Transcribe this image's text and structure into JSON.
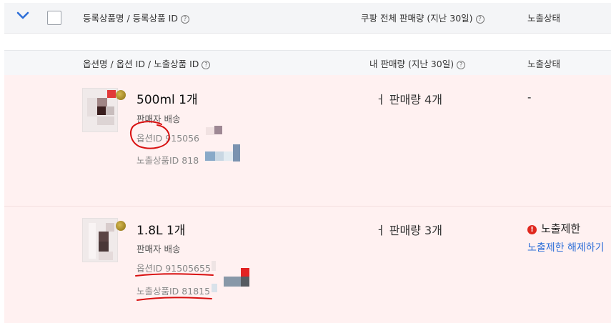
{
  "header": {
    "product_col": "등록상품명 / 등록상품 ID",
    "sales_col": "쿠팡 전체 판매량 (지난 30일)",
    "status_col": "노출상태",
    "help_glyph": "?"
  },
  "subheader": {
    "option_col": "옵션명 / 옵션 ID / 노출상품 ID",
    "sales_col": "내 판매량 (지난 30일)",
    "status_col": "노출상태",
    "help_glyph": "?"
  },
  "rows": [
    {
      "title": "500ml 1개",
      "shipping": "판매자 배송",
      "option_id": "옵션ID 915056",
      "exposure_id": "노출상품ID 818",
      "sales": "ㅓ 판매량 4개",
      "status": "-"
    },
    {
      "title": "1.8L 1개",
      "shipping": "판매자 배송",
      "option_id": "옵션ID 91505655",
      "exposure_id": "노출상품ID 81815",
      "sales": "ㅓ 판매량 3개",
      "status": "노출제한",
      "status_icon": "!",
      "action_link": "노출제한 해제하기"
    }
  ],
  "colors": {
    "row_bg": "#fff1f1",
    "header_bg": "#f4f5f7",
    "link": "#2e6fd8",
    "error": "#e0281e",
    "annotation": "#d81010",
    "chevron": "#2e6fd8"
  }
}
